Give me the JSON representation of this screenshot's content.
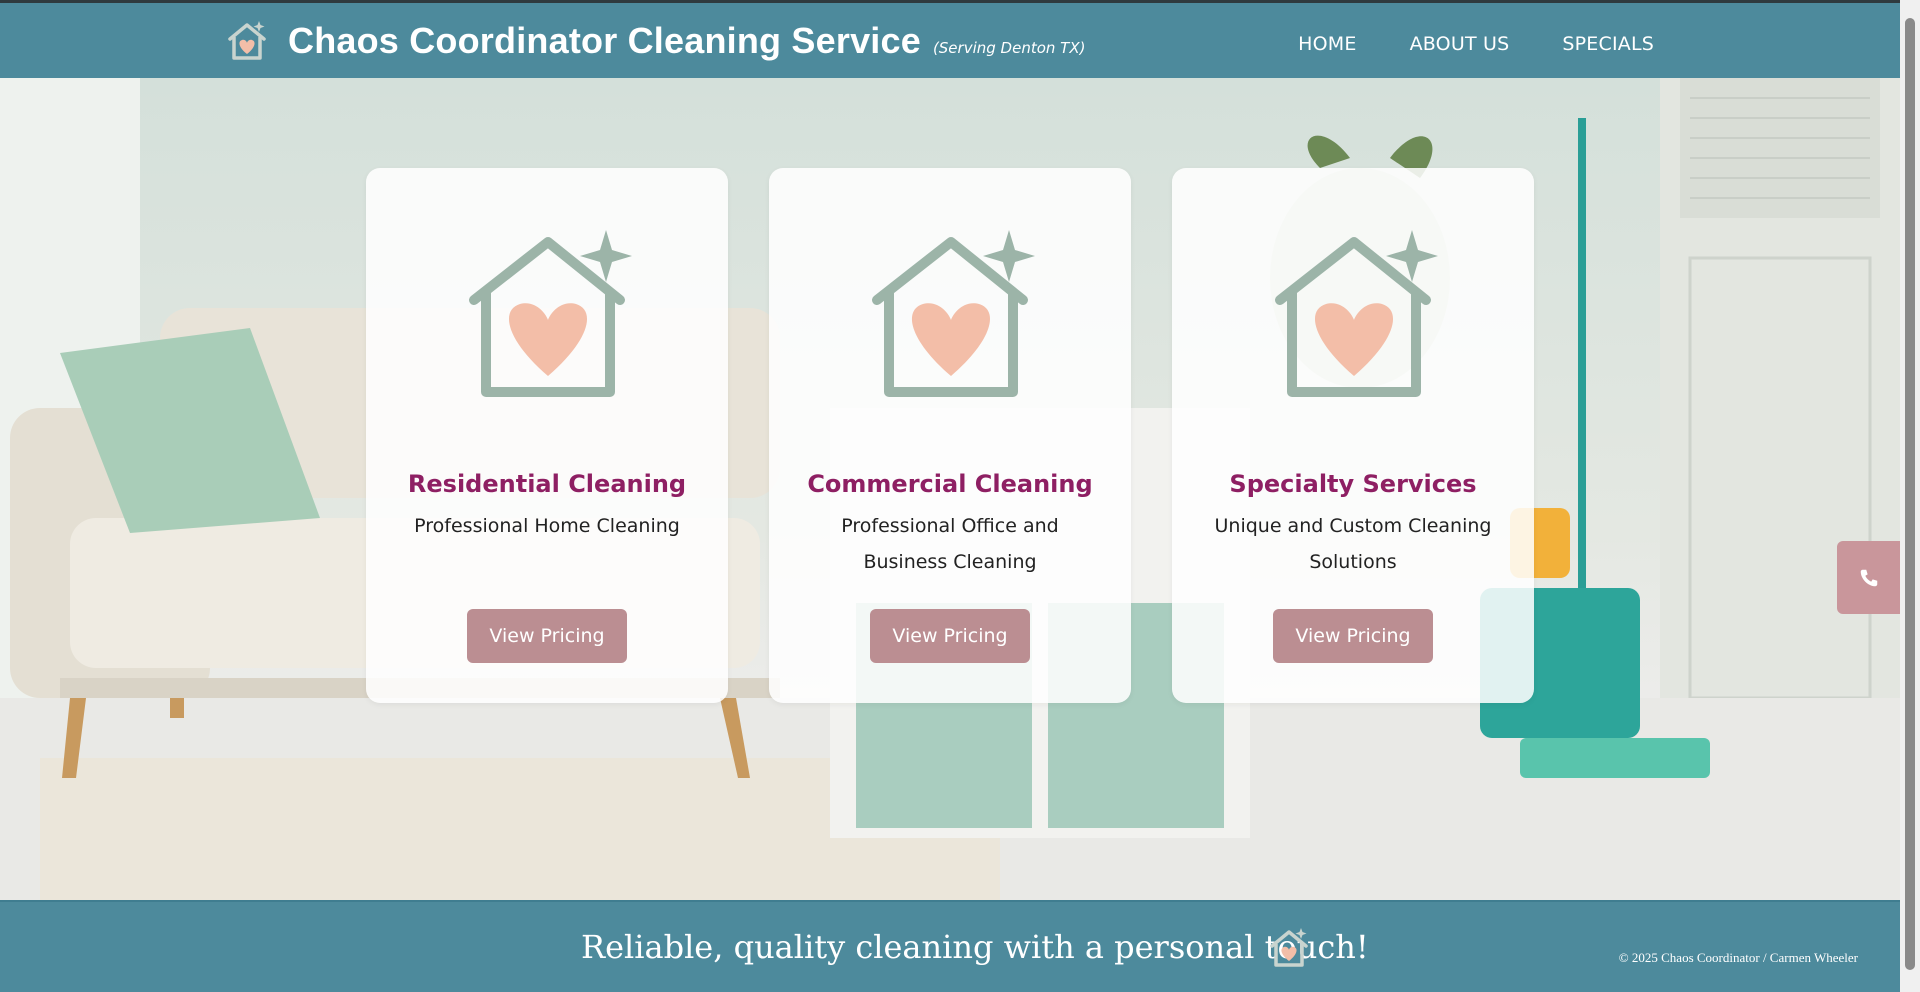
{
  "header": {
    "title": "Chaos Coordinator Cleaning Service",
    "subtitle": "(Serving Denton TX)",
    "nav": [
      "HOME",
      "ABOUT US",
      "SPECIALS"
    ]
  },
  "cards": [
    {
      "title": "Residential Cleaning",
      "description": "Professional Home Cleaning",
      "button": "View Pricing"
    },
    {
      "title": "Commercial Cleaning",
      "description": "Professional Office and Business Cleaning",
      "button": "View Pricing"
    },
    {
      "title": "Specialty Services",
      "description": "Unique and Custom Cleaning Solutions",
      "button": "View Pricing"
    }
  ],
  "footer": {
    "tagline": "Reliable, quality cleaning with a personal touch!",
    "copyright": "© 2025 Chaos Coordinator / Carmen Wheeler"
  },
  "icons": {
    "logo": "house-heart-sparkle-icon",
    "card_icon": "house-heart-sparkle-icon",
    "phone": "phone-icon"
  },
  "colors": {
    "header_bg": "#4d8a9c",
    "card_title": "#8e1f63",
    "button_bg": "#bb8e92",
    "icon_stroke": "#9cb4a8",
    "heart": "#f3bea8",
    "phone_tab": "#c9969b"
  }
}
